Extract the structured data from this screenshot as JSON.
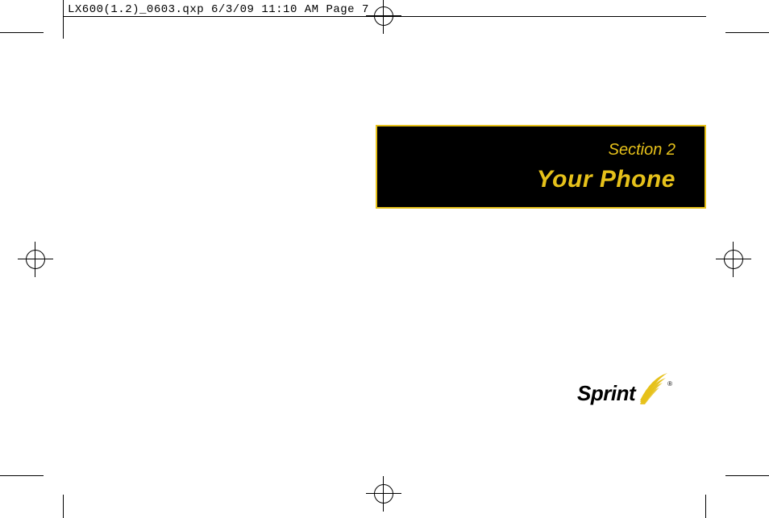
{
  "header": {
    "slug": "LX600(1.2)_0603.qxp  6/3/09  11:10 AM  Page 7"
  },
  "section": {
    "label": "Section 2",
    "title": "Your Phone"
  },
  "logo": {
    "brand": "Sprint",
    "registered": "®"
  }
}
